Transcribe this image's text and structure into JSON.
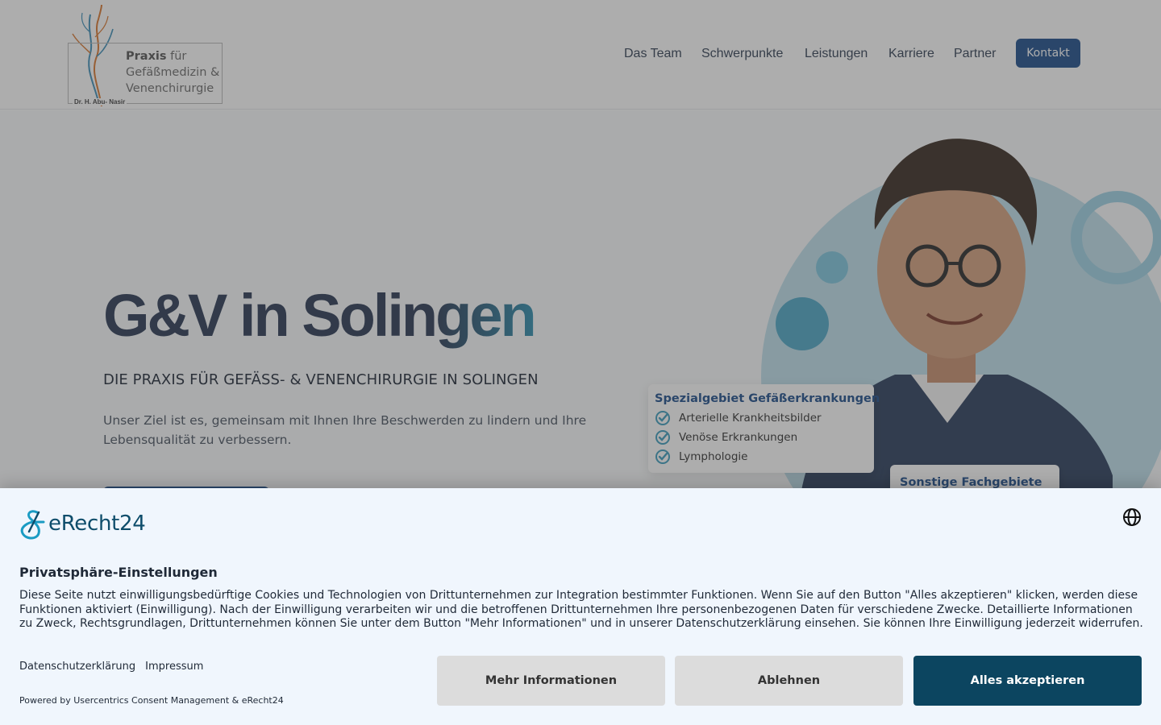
{
  "logo": {
    "line1_bold": "Praxis",
    "line1_rest": " für",
    "line2": "Gefäßmedizin &",
    "line3": "Venenchirurgie",
    "doctor": "Dr. H. Abu- Nasir"
  },
  "nav": {
    "items": [
      "Das Team",
      "Schwerpunkte",
      "Leistungen",
      "Karriere",
      "Partner"
    ],
    "cta": "Kontakt"
  },
  "hero": {
    "title_main": "G&V in Solin",
    "title_accent": "gen",
    "subtitle": "DIE PRAXIS FÜR GEFÄSS- & VENENCHIRURGIE IN SOLINGEN",
    "description": "Unser Ziel ist es, gemeinsam mit Ihnen Ihre Beschwerden zu lindern und Ihre Lebensqualität zu verbessern."
  },
  "cards": {
    "special": {
      "title": "Spezialgebiet Gefäßerkrankungen",
      "items": [
        "Arterielle Krankheitsbilder",
        "Venöse Erkrankungen",
        "Lymphologie"
      ]
    },
    "other": {
      "title": "Sonstige Fachgebiete"
    }
  },
  "consent": {
    "brand": "eRecht24",
    "title": "Privatsphäre-Einstellungen",
    "text": "Diese Seite nutzt einwilligungsbedürftige Cookies und Technologien von Drittunternehmen zur Integration bestimmter Funktionen. Wenn Sie auf den Button \"Alles akzeptieren\" klicken, werden diese Funktionen aktiviert (Einwilligung). Nach der Einwilligung verarbeiten wir und die betroffenen Drittunternehmen Ihre personenbezogenen Daten für verschiedene Zwecke. Detaillierte Informationen zu Zweck, Rechtsgrundlagen, Drittunternehmen können Sie unter dem Button \"Mehr Informationen\" und in unserer Datenschutzerklärung einsehen. Sie können Ihre Einwilligung jederzeit widerrufen.",
    "link_privacy": "Datenschutzerklärung",
    "link_imprint": "Impressum",
    "powered_by": "Powered by Usercentrics Consent Management & eRecht24",
    "btn_more": "Mehr Informationen",
    "btn_decline": "Ablehnen",
    "btn_accept": "Alles akzeptieren"
  },
  "colors": {
    "primary": "#1e4e8c",
    "consent_primary": "#0c4560",
    "accent": "#2f8fb0",
    "consent_bg": "#f0f6fd"
  }
}
